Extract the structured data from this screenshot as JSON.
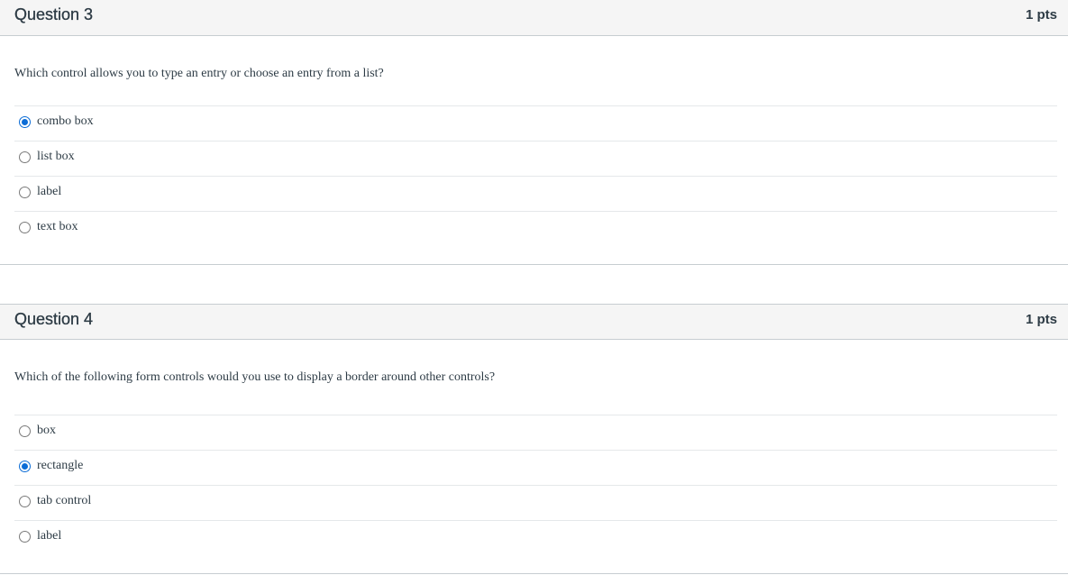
{
  "questions": [
    {
      "title": "Question 3",
      "points": "1 pts",
      "text": "Which control allows you to type an entry or choose an entry from a list?",
      "answers": [
        {
          "label": "combo box",
          "selected": true
        },
        {
          "label": "list box",
          "selected": false
        },
        {
          "label": "label",
          "selected": false
        },
        {
          "label": "text box",
          "selected": false
        }
      ]
    },
    {
      "title": "Question 4",
      "points": "1 pts",
      "text": "Which of the following form controls would you use to display a border around other controls?",
      "answers": [
        {
          "label": "box",
          "selected": false
        },
        {
          "label": "rectangle",
          "selected": true
        },
        {
          "label": "tab control",
          "selected": false
        },
        {
          "label": "label",
          "selected": false
        }
      ]
    }
  ],
  "colors": {
    "header_bg": "#f5f5f5",
    "text": "#2d3b45",
    "radio_selected": "#0b6cd6",
    "divider": "#e5e8ea"
  },
  "icons": {
    "selected_radio": "radio-selected-icon",
    "unselected_radio": "radio-unselected-icon"
  }
}
